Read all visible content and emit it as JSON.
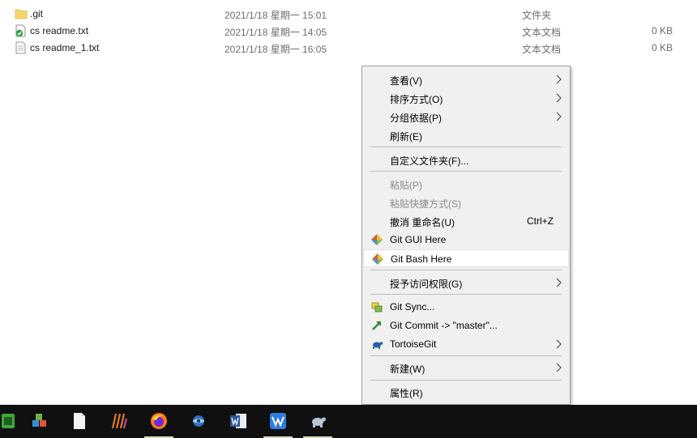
{
  "files": [
    {
      "name": ".git",
      "date": "2021/1/18 星期一 15:01",
      "type": "文件夹",
      "size": "",
      "icon": "folder-icon"
    },
    {
      "name": "cs readme.txt",
      "date": "2021/1/18 星期一 14:05",
      "type": "文本文档",
      "size": "0 KB",
      "icon": "git-clean-text-file-icon"
    },
    {
      "name": "cs readme_1.txt",
      "date": "2021/1/18 星期一 16:05",
      "type": "文本文档",
      "size": "0 KB",
      "icon": "text-file-icon"
    }
  ],
  "context_menu": {
    "view": "查看(V)",
    "sort_by": "排序方式(O)",
    "group_by": "分组依据(P)",
    "refresh": "刷新(E)",
    "customize_folder": "自定义文件夹(F)...",
    "paste": "粘贴(P)",
    "paste_shortcut": "粘贴快捷方式(S)",
    "undo_rename": "撤消 重命名(U)",
    "undo_shortcut": "Ctrl+Z",
    "git_gui": "Git GUI Here",
    "git_bash": "Git Bash Here",
    "grant_access": "授予访问权限(G)",
    "git_sync": "Git Sync...",
    "git_commit": "Git Commit -> \"master\"...",
    "tortoisegit": "TortoiseGit",
    "new": "新建(W)",
    "properties": "属性(R)"
  },
  "taskbar": {
    "items": [
      {
        "icon": "green-app-icon",
        "active": false
      },
      {
        "icon": "package-cubes-icon",
        "active": false
      },
      {
        "icon": "notepad-document-icon",
        "active": false
      },
      {
        "icon": "stripes-app-icon",
        "active": false
      },
      {
        "icon": "firefox-icon",
        "active": true
      },
      {
        "icon": "globe-app-icon",
        "active": false
      },
      {
        "icon": "word-icon",
        "active": false
      },
      {
        "icon": "wps-icon",
        "active": true
      },
      {
        "icon": "tortoisegit-icon",
        "active": true
      }
    ]
  },
  "colors": {
    "menu_bg": "#f0f0f0",
    "hover_bg": "#ffffff",
    "taskbar_bg": "#101010",
    "disabled_text": "#8a8a8a",
    "folder_yellow": "#f5d66b"
  }
}
